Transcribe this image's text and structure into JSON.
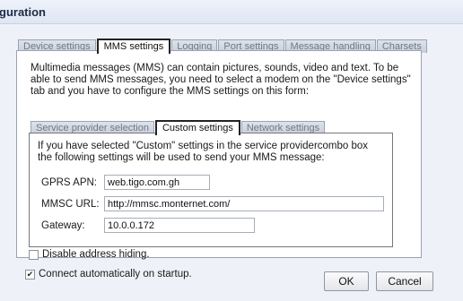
{
  "window": {
    "title": "guration"
  },
  "main_tabs": [
    {
      "label": "Device settings",
      "active": false
    },
    {
      "label": "MMS settings",
      "active": true
    },
    {
      "label": "Logging",
      "active": false
    },
    {
      "label": "Port settings",
      "active": false
    },
    {
      "label": "Message handling",
      "active": false
    },
    {
      "label": "Charsets",
      "active": false
    }
  ],
  "mms": {
    "description": [
      "Multimedia messages (MMS) can contain pictures, sounds, video and text. To be",
      "able to send MMS messages, you need to select a modem on the \"Device settings\"",
      "tab and you have to configure the MMS settings on this form:"
    ]
  },
  "sub_tabs": [
    {
      "label": "Service provider selection",
      "active": false
    },
    {
      "label": "Custom settings",
      "active": true
    },
    {
      "label": "Network settings",
      "active": false
    }
  ],
  "custom": {
    "description": [
      "If you have selected \"Custom\" settings in the service providercombo box",
      "the following settings will be used to send your MMS message:"
    ],
    "gprs_apn": {
      "label": "GPRS APN:",
      "value": "web.tigo.com.gh"
    },
    "mmsc_url": {
      "label": "MMSC URL:",
      "value": "http://mmsc.monternet.com/"
    },
    "gateway": {
      "label": "Gateway:",
      "value": "10.0.0.172"
    }
  },
  "options": {
    "disable_address_hiding": {
      "label": "Disable address hiding.",
      "checked": false
    },
    "connect_on_startup": {
      "label": "Connect automatically on startup.",
      "checked": true
    }
  },
  "buttons": {
    "ok": "OK",
    "cancel": "Cancel"
  }
}
